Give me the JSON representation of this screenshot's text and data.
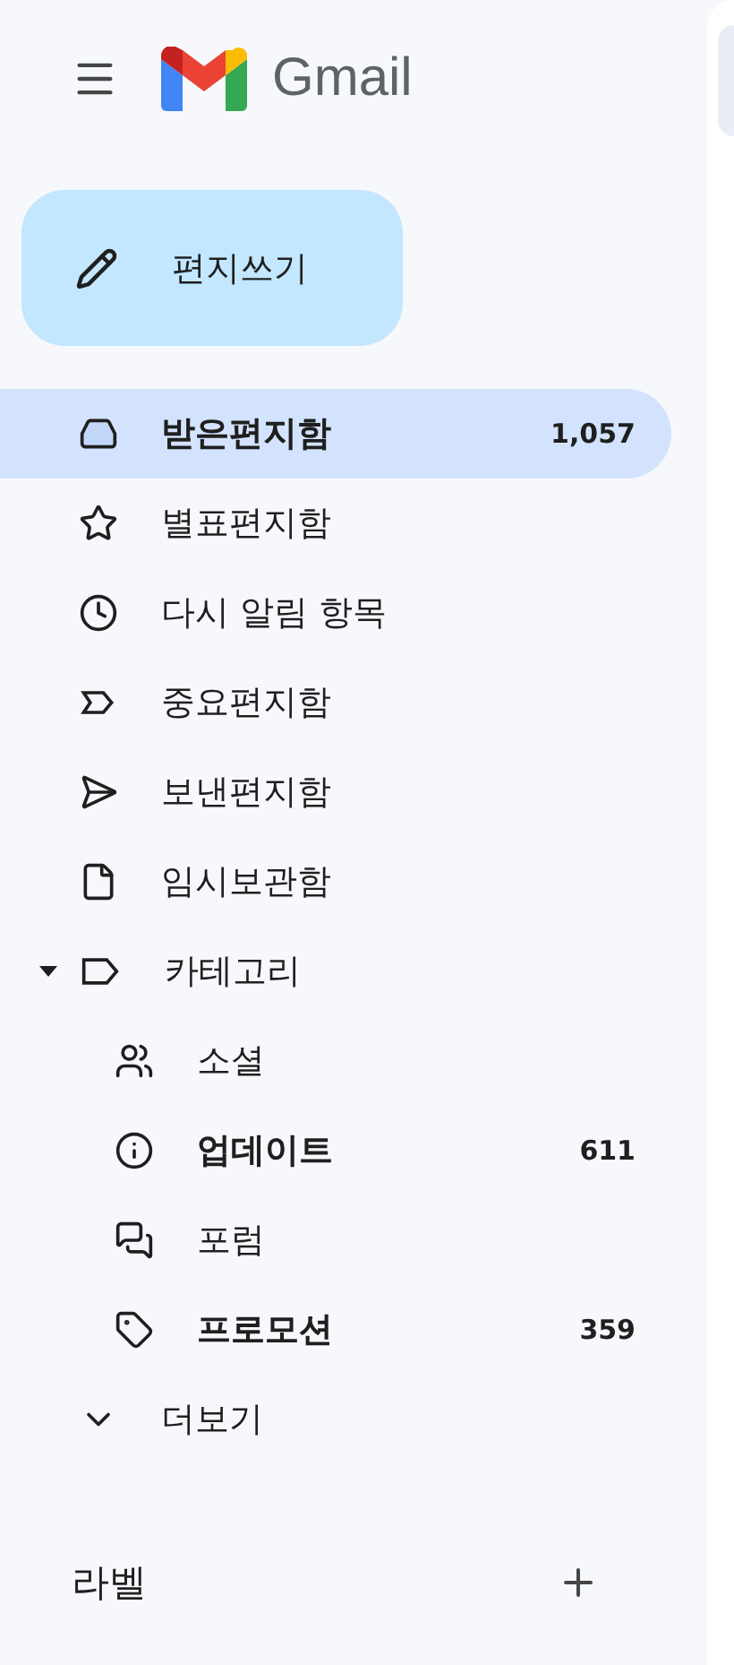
{
  "header": {
    "app_name": "Gmail"
  },
  "compose": {
    "label": "편지쓰기"
  },
  "nav": [
    {
      "kind": "inbox",
      "label": "받은편지함",
      "count": "1,057",
      "selected": true,
      "unread": true
    },
    {
      "kind": "star",
      "label": "별표편지함",
      "selected": false,
      "unread": false
    },
    {
      "kind": "snoozed",
      "label": "다시 알림 항목",
      "selected": false,
      "unread": false
    },
    {
      "kind": "important",
      "label": "중요편지함",
      "selected": false,
      "unread": false
    },
    {
      "kind": "sent",
      "label": "보낸편지함",
      "selected": false,
      "unread": false
    },
    {
      "kind": "drafts",
      "label": "임시보관함",
      "selected": false,
      "unread": false
    },
    {
      "kind": "category",
      "label": "카테고리",
      "selected": false,
      "unread": false,
      "expanded": true,
      "children": [
        {
          "kind": "social",
          "label": "소셜",
          "selected": false,
          "unread": false
        },
        {
          "kind": "updates",
          "label": "업데이트",
          "count": "611",
          "selected": false,
          "unread": true
        },
        {
          "kind": "forums",
          "label": "포럼",
          "selected": false,
          "unread": false
        },
        {
          "kind": "promotions",
          "label": "프로모션",
          "count": "359",
          "selected": false,
          "unread": true
        }
      ]
    },
    {
      "kind": "more",
      "label": "더보기",
      "selected": false,
      "unread": false
    }
  ],
  "labels": {
    "title": "라벨"
  }
}
